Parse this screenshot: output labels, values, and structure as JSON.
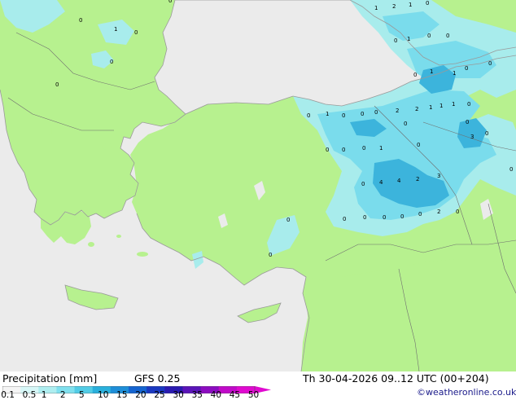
{
  "map": {
    "colors": {
      "sea": "#ebebeb",
      "land": "#b7f18f",
      "precip_light": "#a8ecec",
      "precip_mid": "#7adcec",
      "precip_heavy": "#3cb4dc",
      "coast": "#9a9a9a",
      "border": "#6f6f6f"
    },
    "point_values": [
      {
        "value": "1"
      },
      {
        "value": "2"
      },
      {
        "value": "1"
      },
      {
        "value": "0"
      },
      {
        "value": "0"
      },
      {
        "value": "0"
      },
      {
        "value": "1"
      },
      {
        "value": "0"
      },
      {
        "value": "0"
      },
      {
        "value": "0"
      },
      {
        "value": "1"
      },
      {
        "value": "0"
      },
      {
        "value": "0"
      },
      {
        "value": "0"
      },
      {
        "value": "1"
      },
      {
        "value": "0"
      },
      {
        "value": "0"
      },
      {
        "value": "1"
      },
      {
        "value": "1"
      },
      {
        "value": "1"
      },
      {
        "value": "0"
      },
      {
        "value": "0"
      },
      {
        "value": "0"
      },
      {
        "value": "2"
      },
      {
        "value": "2"
      },
      {
        "value": "1"
      },
      {
        "value": "0"
      },
      {
        "value": "0"
      },
      {
        "value": "0"
      },
      {
        "value": "1"
      },
      {
        "value": "0"
      },
      {
        "value": "0"
      },
      {
        "value": "3"
      },
      {
        "value": "0"
      },
      {
        "value": "0"
      },
      {
        "value": "4"
      },
      {
        "value": "4"
      },
      {
        "value": "2"
      },
      {
        "value": "3"
      },
      {
        "value": "0"
      },
      {
        "value": "0"
      },
      {
        "value": "0"
      },
      {
        "value": "0"
      },
      {
        "value": "0"
      },
      {
        "value": "0"
      },
      {
        "value": "0"
      },
      {
        "value": "2"
      },
      {
        "value": "0"
      },
      {
        "value": "0"
      },
      {
        "value": "0"
      },
      {
        "value": "1"
      },
      {
        "value": "0"
      },
      {
        "value": "0"
      },
      {
        "value": "0"
      }
    ]
  },
  "footer": {
    "title": "Precipitation [mm]",
    "model": "GFS 0.25",
    "datetime": "Th 30-04-2026 09..12 UTC (00+204)",
    "copyright": "©weatheronline.co.uk"
  },
  "scale": {
    "colors": [
      "#f5f5f5",
      "#d7f7f7",
      "#aeeef0",
      "#80e0ee",
      "#52cce6",
      "#2ab0dc",
      "#1e8ed8",
      "#1464d0",
      "#1a38c0",
      "#2a1ab0",
      "#5a14b8",
      "#8c0cc0",
      "#c00ac8",
      "#e00ad0"
    ],
    "labels": [
      {
        "text": "0.1",
        "pos": 0.02
      },
      {
        "text": "0.5",
        "pos": 0.1
      },
      {
        "text": "1",
        "pos": 0.155
      },
      {
        "text": "2",
        "pos": 0.225
      },
      {
        "text": "5",
        "pos": 0.295
      },
      {
        "text": "10",
        "pos": 0.375
      },
      {
        "text": "15",
        "pos": 0.445
      },
      {
        "text": "20",
        "pos": 0.515
      },
      {
        "text": "25",
        "pos": 0.585
      },
      {
        "text": "30",
        "pos": 0.655
      },
      {
        "text": "35",
        "pos": 0.725
      },
      {
        "text": "40",
        "pos": 0.795
      },
      {
        "text": "45",
        "pos": 0.865
      },
      {
        "text": "50",
        "pos": 0.935
      }
    ]
  }
}
